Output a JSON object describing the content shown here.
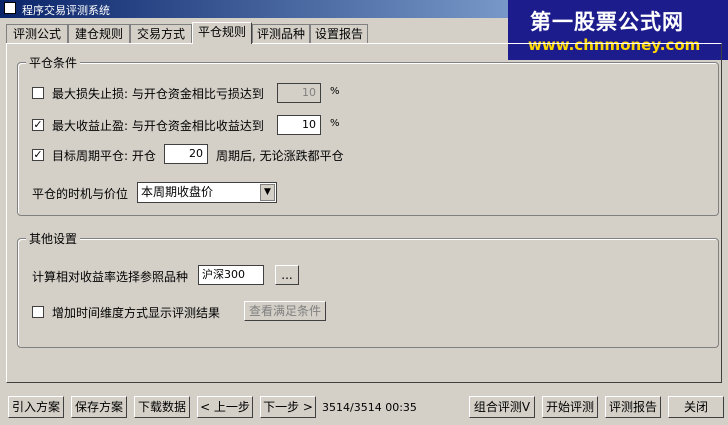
{
  "window": {
    "title": "程序交易评测系统"
  },
  "watermark": {
    "line1": "第一股票公式网",
    "line2": "www.chnmoney.com"
  },
  "tabs": [
    "评测公式",
    "建仓规则",
    "交易方式",
    "平仓规则",
    "评测品种",
    "设置报告"
  ],
  "close_conditions": {
    "title": "平仓条件",
    "max_loss": {
      "checked": false,
      "label": "最大损失止损: 与开仓资金相比亏损达到",
      "value": "10",
      "unit": "%"
    },
    "max_profit": {
      "checked": true,
      "label": "最大收益止盈: 与开仓资金相比收益达到",
      "value": "10",
      "unit": "%"
    },
    "target_period": {
      "checked": true,
      "label": "目标周期平仓: 开仓",
      "value": "20",
      "suffix": "周期后, 无论涨跌都平仓"
    },
    "timing": {
      "label": "平仓的时机与价位",
      "selected": "本周期收盘价"
    }
  },
  "other_settings": {
    "title": "其他设置",
    "benchmark": {
      "label": "计算相对收益率选择参照品种",
      "value": "沪深300",
      "browse": "..."
    },
    "time_dimension": {
      "checked": false,
      "label": "增加时间维度方式显示评测结果",
      "button": "查看满足条件"
    }
  },
  "bottom": {
    "import": "引入方案",
    "save": "保存方案",
    "download": "下载数据",
    "prev": "< 上一步",
    "next": "下一步 >",
    "status": "3514/3514 00:35",
    "combo": "组合评测V",
    "start": "开始评测",
    "report": "评测报告",
    "close": "关闭"
  },
  "check_mark": "✓"
}
